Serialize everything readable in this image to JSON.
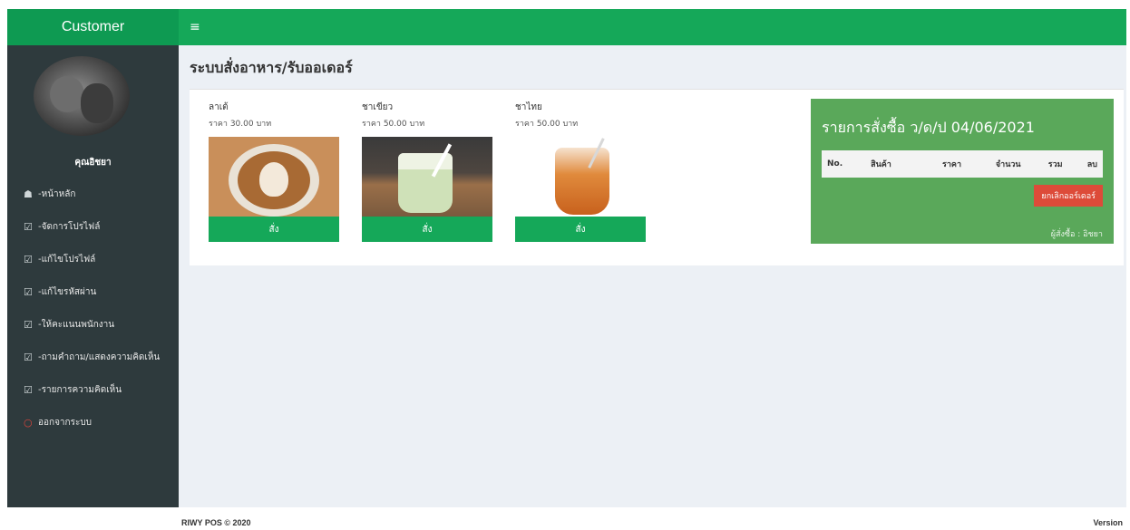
{
  "brand": "Customer",
  "icons": {
    "menu_toggle": "≡",
    "home": "☗",
    "edit": "☑",
    "logout": "○"
  },
  "user": {
    "name": "คุณอิชยา"
  },
  "menu": [
    {
      "label": "-หน้าหลัก",
      "icon": "home"
    },
    {
      "label": "-จัดการโปรไฟล์",
      "icon": "edit"
    },
    {
      "label": "-แก้ไขโปรไฟล์",
      "icon": "edit"
    },
    {
      "label": "-แก้ไขรหัสผ่าน",
      "icon": "edit"
    },
    {
      "label": "-ให้คะแนนพนักงาน",
      "icon": "edit"
    },
    {
      "label": "-ถามคำถาม/แสดงความคิดเห็น",
      "icon": "edit"
    },
    {
      "label": "-รายการความคิดเห็น",
      "icon": "edit"
    },
    {
      "label": "ออกจากระบบ",
      "icon": "logout"
    }
  ],
  "page": {
    "title": "ระบบสั่งอาหาร/รับออเดอร์"
  },
  "products": [
    {
      "name": "ลาเต้",
      "price": "ราคา 30.00 บาท",
      "button": "สั่ง"
    },
    {
      "name": "ชาเขียว",
      "price": "ราคา 50.00 บาท",
      "button": "สั่ง"
    },
    {
      "name": "ชาไทย",
      "price": "ราคา 50.00 บาท",
      "button": "สั่ง"
    }
  ],
  "order": {
    "title": "รายการสั่งซื้อ ว/ด/ป 04/06/2021",
    "columns": [
      "No.",
      "สินค้า",
      "ราคา",
      "จำนวน",
      "รวม",
      "ลบ"
    ],
    "cancel_label": "ยกเลิกออร์เดอร์",
    "buyer": "ผู้สั่งซื้อ : อิชยา"
  },
  "footer": {
    "copyright": "RIWY POS © 2020",
    "version": "Version"
  },
  "colors": {
    "brand": "#0e9a52",
    "topbar": "#15a859",
    "sidebar": "#2e3a3d",
    "order_box": "#5aa85a",
    "cancel": "#dd4b39"
  }
}
